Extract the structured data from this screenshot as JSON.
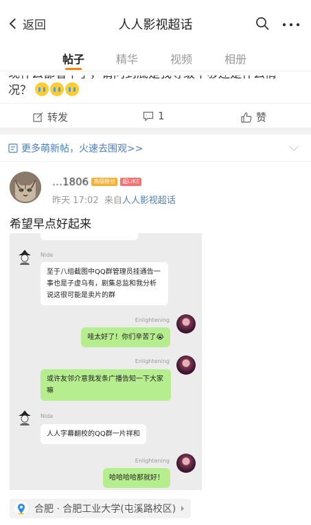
{
  "header": {
    "back_label": "返回",
    "title": "人人影视超话"
  },
  "tabs": [
    {
      "label": "帖子",
      "active": true
    },
    {
      "label": "精华",
      "active": false
    },
    {
      "label": "视频",
      "active": false
    },
    {
      "label": "相册",
      "active": false
    }
  ],
  "prev_post": {
    "text_line1": "现什么都看不了，请问到底是我等级不够还是什么情",
    "text_line2": "况？",
    "actions": {
      "repost_label": "转发",
      "comment_count": "1",
      "like_label": "赞"
    }
  },
  "banner": {
    "text": "更多萌新帖，火速去围观>>"
  },
  "post": {
    "username": "…1806",
    "badge_fan": "高级粉丝",
    "badge_super": "超LIKE",
    "time": "昨天 17:02",
    "from_prefix": "来自",
    "source": "人人影视超话",
    "text": "希望早点好起来",
    "location": "合肥 · 合肥工业大学(屯溪路校区)"
  },
  "chat": {
    "nick_nida_1": "Nida",
    "msg_nida_1": "至于八组截图中QQ群管理员挂通告一事也是子虚乌有，剧集总监和我分析说这很可能是卖片的群",
    "nick_en_1": "Enlightening",
    "msg_en_1": "哇太好了！你们辛苦了😭",
    "nick_en_2": "Enlightening",
    "msg_en_2": "或许友邻介意我发条广播告知一下大家嘛",
    "nick_nida_2": "Nida",
    "msg_nida_2": "人人字幕翻校的QQ群一片祥和",
    "nick_en_3": "Enlightening",
    "msg_en_3": "哈哈哈哈那就好！"
  },
  "colors": {
    "accent": "#ff8200",
    "link": "#4a7fc1",
    "bubble_green": "#b6ee8f"
  }
}
